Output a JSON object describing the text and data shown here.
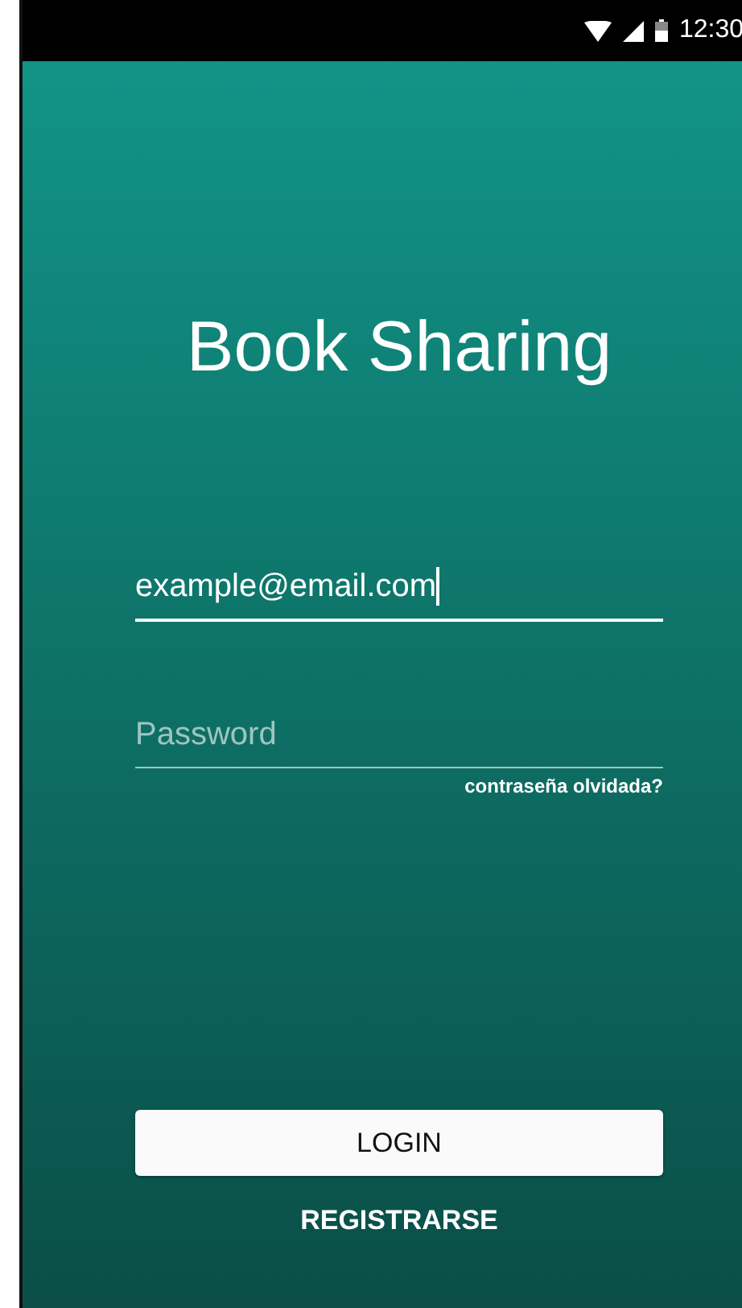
{
  "status_bar": {
    "time": "12:30"
  },
  "title": "Book Sharing",
  "fields": [
    {
      "kind": "email",
      "value": "example@email.com",
      "focused": true
    },
    {
      "kind": "password",
      "placeholder": "Password",
      "focused": false
    }
  ],
  "forgot_link": "contraseña olvidada?",
  "login_button": "LOGIN",
  "register_button": "REGISTRARSE"
}
